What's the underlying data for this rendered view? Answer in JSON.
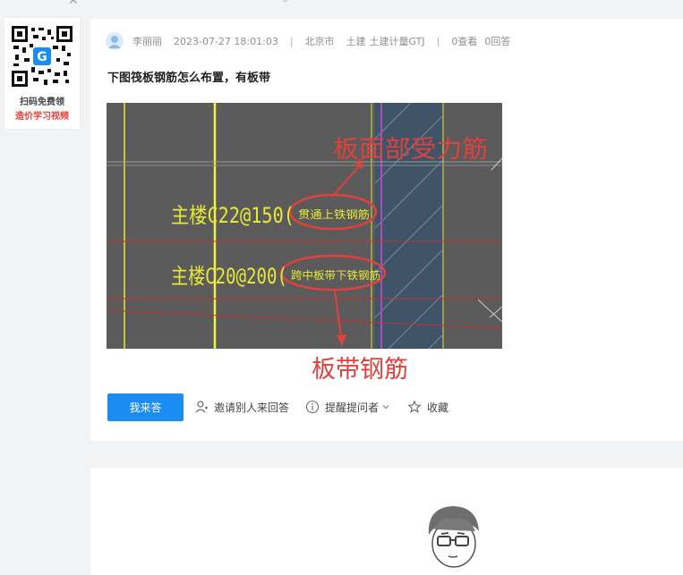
{
  "qr_promo": {
    "line1": "扫码免费领",
    "line2": "造价学习视频"
  },
  "question": {
    "author": "李丽丽",
    "datetime": "2023-07-27 18:01:03",
    "separator": "|",
    "location": "北京市",
    "tags": [
      "土建",
      "土建计量GTJ"
    ],
    "views": "0查看",
    "answers": "0回答",
    "title": "下图筏板钢筋怎么布置，有板带",
    "image": {
      "label_top": "板面部受力筋",
      "label_main1": "主楼C22@150(",
      "label_circle1": "贯通上铁钢筋",
      "label_main2": "主楼C20@200(",
      "label_circle2": "跨中板带下铁钢筋",
      "label_bottom": "板带钢筋"
    }
  },
  "actions": {
    "answer_button": "我来答",
    "invite": "邀请别人来回答",
    "remind": "提醒提问者",
    "favorite": "收藏"
  },
  "colors": {
    "brand_blue": "#1b8cf2",
    "annotation_red": "#e0413c",
    "cad_yellow": "#e8e838"
  }
}
